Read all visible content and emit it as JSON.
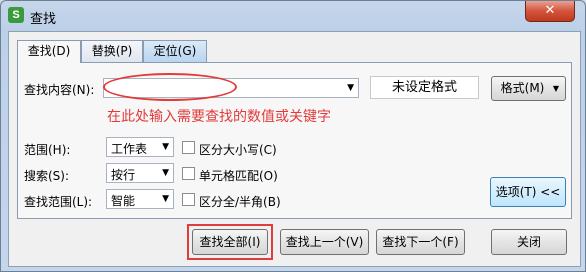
{
  "window": {
    "title": "查找",
    "icon": "S",
    "close": "✕"
  },
  "tabs": [
    {
      "label": "查找(D)"
    },
    {
      "label": "替换(P)"
    },
    {
      "label": "定位(G)"
    }
  ],
  "find": {
    "label": "查找内容(N):",
    "value": "",
    "format_status": "未设定格式",
    "format_button": "格式(M)",
    "annotation": "在此处输入需要查找的数值或关键字"
  },
  "options": {
    "scope_label": "范围(H):",
    "scope_value": "工作表",
    "search_label": "搜索(S):",
    "search_value": "按行",
    "lookin_label": "查找范围(L):",
    "lookin_value": "智能",
    "case_label": "区分大小写(C)",
    "cell_label": "单元格匹配(O)",
    "width_label": "区分全/半角(B)",
    "options_button": "选项(T) <<"
  },
  "buttons": {
    "find_all": "查找全部(I)",
    "find_prev": "查找上一个(V)",
    "find_next": "查找下一个(F)",
    "close": "关闭"
  },
  "colors": {
    "annotation_red": "#e23b3b"
  }
}
